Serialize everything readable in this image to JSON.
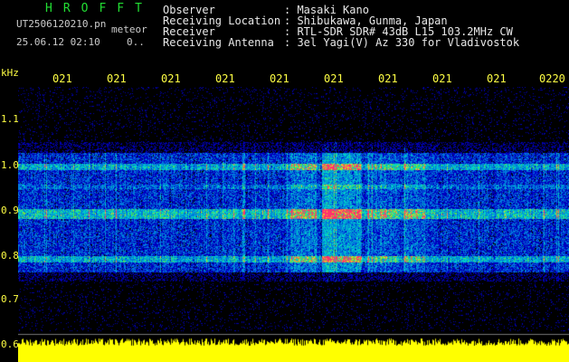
{
  "header": {
    "title": "HROFFT",
    "filename": "UT2506120210.pn",
    "tag": "meteor",
    "datetime": "25.06.12 02:10",
    "extra": "0.."
  },
  "info": [
    {
      "label": "Observer",
      "value": ": Masaki Kano"
    },
    {
      "label": "Receiving Location",
      "value": ": Shibukawa, Gunma, Japan"
    },
    {
      "label": "Receiver",
      "value": ": RTL-SDR SDR# 43dB L15 103.2MHz CW"
    },
    {
      "label": "Receiving Antenna",
      "value": ": 3el Yagi(V) Az 330 for Vladivostok"
    }
  ],
  "axis": {
    "unit": "kHz",
    "x_ticks": [
      "021",
      "021",
      "021",
      "021",
      "021",
      "021",
      "021",
      "021",
      "021",
      "0220"
    ],
    "y_ticks": [
      "1.1",
      "1.0",
      "0.9",
      "0.8",
      "0.7",
      "0.6"
    ]
  },
  "colors": {
    "background": "#000000",
    "label": "#ffff44",
    "title": "#22dd33",
    "noise_low": "#0000aa",
    "noise_mid": "#00cccc",
    "echo": "#ff3377",
    "level_bar": "#ffff00"
  }
}
